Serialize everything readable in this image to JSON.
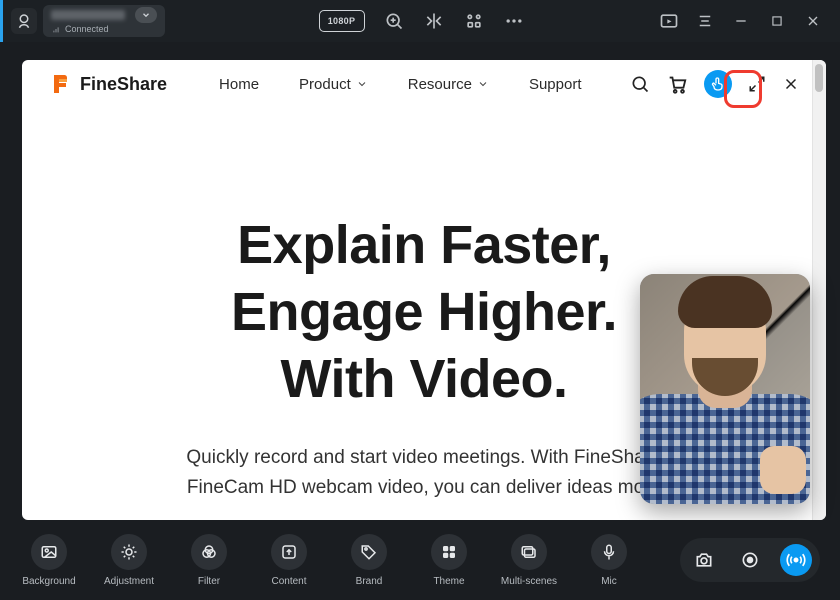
{
  "titlebar": {
    "connected_label": "Connected",
    "resolution": "1080P"
  },
  "site": {
    "brand": "FineShare",
    "nav": {
      "home": "Home",
      "product": "Product",
      "resource": "Resource",
      "support": "Support"
    },
    "headline_l1": "Explain Faster,",
    "headline_l2": "Engage Higher.",
    "headline_l3": "With Video.",
    "sub_l1": "Quickly record and start video meetings. With FineShare",
    "sub_l2": "FineCam HD webcam video, you can deliver ideas more"
  },
  "controls": {
    "background": "Background",
    "adjustment": "Adjustment",
    "filter": "Filter",
    "content": "Content",
    "brand": "Brand",
    "theme": "Theme",
    "multi_scenes": "Multi-scenes",
    "mic": "Mic"
  }
}
